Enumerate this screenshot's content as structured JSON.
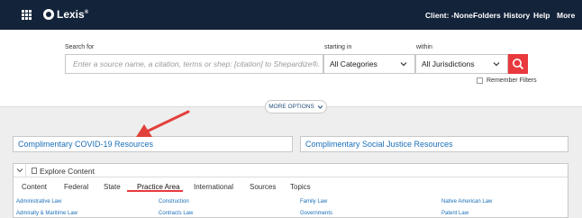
{
  "header": {
    "logo": "Lexis",
    "logo_mark": "®",
    "client_label": "Client: -None-",
    "nav": [
      "Folders",
      "History",
      "Help",
      "More"
    ]
  },
  "search": {
    "search_for_label": "Search for",
    "placeholder": "Enter a source name, a citation, terms or shep: [citation] to Shepardize®.",
    "starting_in_label": "starting in",
    "category_value": "All Categories",
    "within_label": "within",
    "jurisdiction_value": "All Jurisdictions",
    "remember_filters": "Remember Filters",
    "more_options": "MORE OPTIONS"
  },
  "resources": {
    "covid": "Complimentary COVID-19 Resources",
    "social_justice": "Complimentary Social Justice Resources"
  },
  "explore": {
    "title": "Explore Content",
    "tabs": [
      "Content",
      "Federal",
      "State",
      "Practice Area",
      "International",
      "Sources",
      "Topics"
    ],
    "active_tab": "Practice Area",
    "links": {
      "col1": [
        "Administrative Law",
        "Admiralty & Maritime Law"
      ],
      "col2": [
        "Construction",
        "Contracts Law"
      ],
      "col3": [
        "Family Law",
        "Governments"
      ],
      "col4": [
        "Native American Law",
        "Patent Law"
      ]
    }
  },
  "colors": {
    "header_bg": "#13233a",
    "accent_red": "#e9393d",
    "link_blue": "#1a6fb9"
  }
}
